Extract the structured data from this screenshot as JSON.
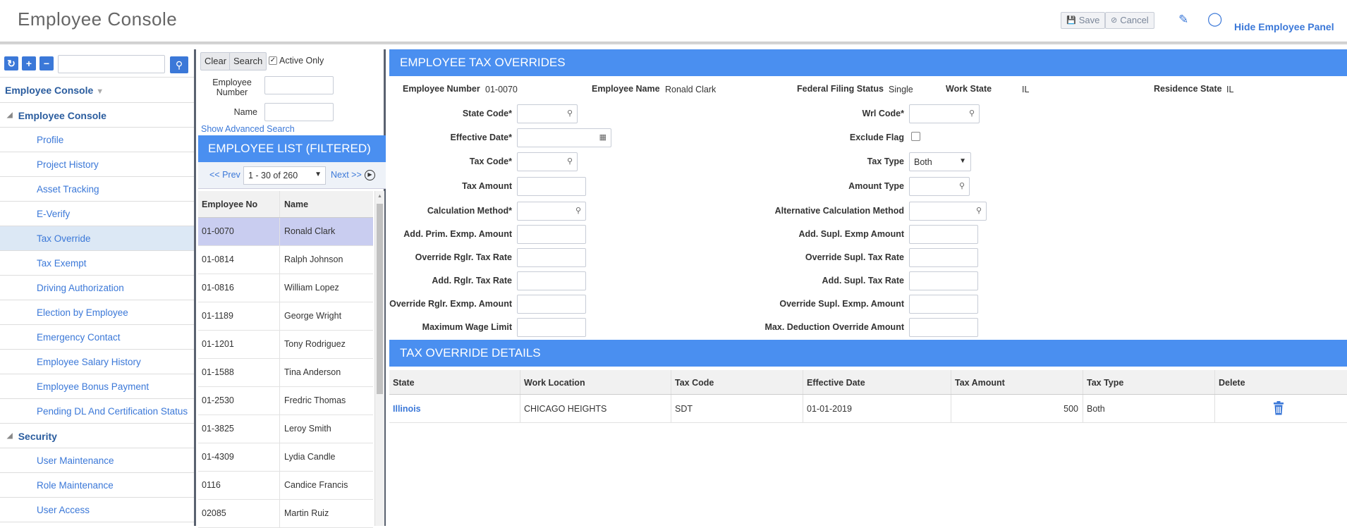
{
  "header": {
    "title": "Employee Console",
    "save_label": "Save",
    "cancel_label": "Cancel",
    "hide_panel_label": "Hide Employee Panel"
  },
  "nav": {
    "root_label": "Employee Console",
    "group_console": "Employee Console",
    "console_items": [
      "Profile",
      "Project History",
      "Asset Tracking",
      "E-Verify",
      "Tax Override",
      "Tax Exempt",
      "Driving Authorization",
      "Election by Employee",
      "Emergency Contact",
      "Employee Salary History",
      "Employee Bonus Payment",
      "Pending DL And Certification Status"
    ],
    "active_item": "Tax Override",
    "group_security": "Security",
    "security_items": [
      "User Maintenance",
      "Role Maintenance",
      "User Access"
    ]
  },
  "search": {
    "clear_label": "Clear",
    "search_label": "Search",
    "active_only_label": "Active Only",
    "active_only_checked": true,
    "employee_number_label": "Employee Number",
    "name_label": "Name",
    "advanced_link": "Show Advanced Search"
  },
  "employee_list": {
    "title": "EMPLOYEE LIST (FILTERED)",
    "prev_label": "<< Prev",
    "next_label": "Next >>",
    "page_range": "1 - 30 of 260",
    "col_no": "Employee No",
    "col_name": "Name",
    "rows": [
      {
        "no": "01-0070",
        "name": "Ronald Clark"
      },
      {
        "no": "01-0814",
        "name": "Ralph Johnson"
      },
      {
        "no": "01-0816",
        "name": "William Lopez"
      },
      {
        "no": "01-1189",
        "name": "George Wright"
      },
      {
        "no": "01-1201",
        "name": "Tony Rodriguez"
      },
      {
        "no": "01-1588",
        "name": "Tina Anderson"
      },
      {
        "no": "01-2530",
        "name": "Fredric Thomas"
      },
      {
        "no": "01-3825",
        "name": "Leroy Smith"
      },
      {
        "no": "01-4309",
        "name": "Lydia Candle"
      },
      {
        "no": "0116",
        "name": "Candice Francis"
      },
      {
        "no": "02085",
        "name": "Martin Ruiz"
      }
    ]
  },
  "overrides": {
    "title": "EMPLOYEE TAX OVERRIDES",
    "emp_number_label": "Employee Number",
    "emp_number": "01-0070",
    "emp_name_label": "Employee Name",
    "emp_name": "Ronald Clark",
    "filing_label": "Federal Filing Status",
    "filing_status": "Single",
    "work_state_label": "Work State",
    "work_state": "IL",
    "res_state_label": "Residence State",
    "res_state": "IL",
    "left_fields": {
      "state_code": "State Code*",
      "effective_date": "Effective Date*",
      "tax_code": "Tax Code*",
      "tax_amount": "Tax Amount",
      "calc_method": "Calculation Method*",
      "add_prim": "Add. Prim. Exmp. Amount",
      "override_rglr_rate": "Override Rglr. Tax Rate",
      "add_rglr_rate": "Add. Rglr. Tax Rate",
      "override_rglr_exmp": "Override Rglr. Exmp. Amount",
      "max_wage": "Maximum Wage Limit"
    },
    "right_fields": {
      "wrl_code": "Wrl Code*",
      "exclude_flag": "Exclude Flag",
      "tax_type": "Tax Type",
      "amount_type": "Amount Type",
      "alt_calc": "Alternative Calculation Method",
      "add_supl_exmp": "Add. Supl. Exmp Amount",
      "override_supl_rate": "Override Supl. Tax Rate",
      "add_supl_rate": "Add. Supl. Tax Rate",
      "override_supl_exmp": "Override Supl. Exmp. Amount",
      "max_deduction": "Max. Deduction Override Amount"
    },
    "tax_type_value": "Both"
  },
  "details": {
    "title": "TAX OVERRIDE DETAILS",
    "columns": [
      "State",
      "Work Location",
      "Tax Code",
      "Effective Date",
      "Tax Amount",
      "Tax Type",
      "Delete"
    ],
    "rows": [
      {
        "state": "Illinois",
        "work_location": "CHICAGO HEIGHTS",
        "tax_code": "SDT",
        "effective_date": "01-01-2019",
        "tax_amount": "500",
        "tax_type": "Both"
      }
    ]
  },
  "colors": {
    "accent": "#4a8ff0",
    "link": "#3b78d8",
    "selected_row": "#c9cdf0",
    "active_nav": "#dce8f5"
  }
}
